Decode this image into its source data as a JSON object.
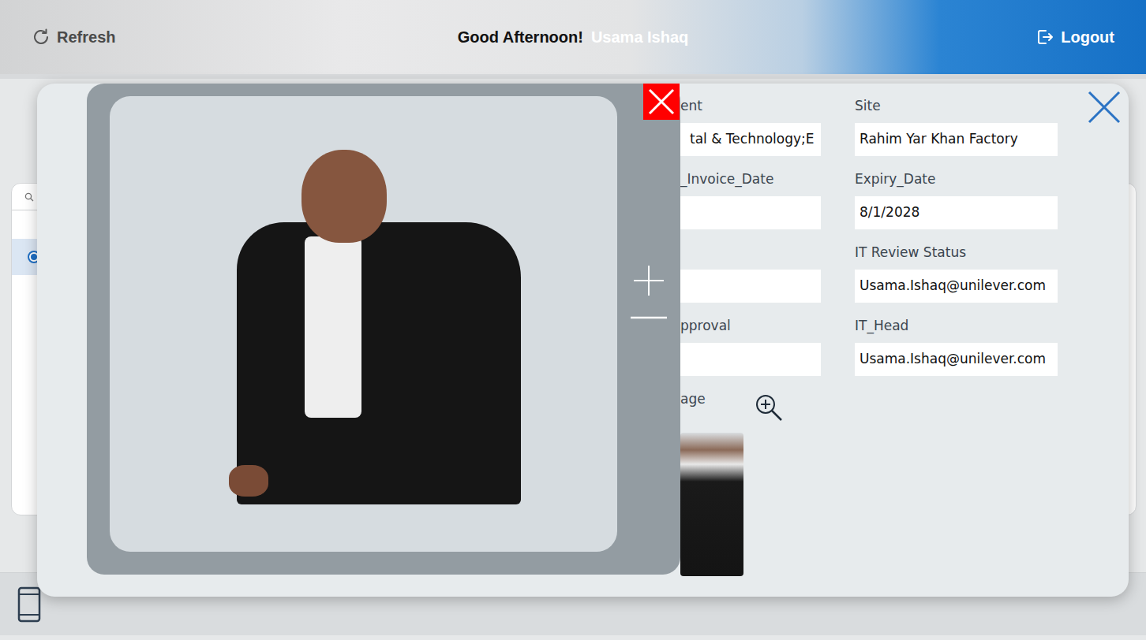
{
  "header": {
    "refresh": "Refresh",
    "greeting": "Good Afternoon!",
    "user": "Usama Ishaq",
    "logout": "Logout"
  },
  "list": {
    "rows": [
      {
        "selected": true
      }
    ]
  },
  "dialog": {
    "left_fields": [
      {
        "label": "ent",
        "value": "tal & Technology;E"
      },
      {
        "label": "_Invoice_Date",
        "value": ""
      },
      {
        "label": "",
        "value": ""
      },
      {
        "label": "pproval",
        "value": ""
      }
    ],
    "image_field": {
      "label": "age"
    },
    "right_fields": [
      {
        "label": "Site",
        "value": "Rahim Yar Khan Factory"
      },
      {
        "label": "Expiry_Date",
        "value": "8/1/2028"
      },
      {
        "label": "IT Review Status",
        "value": "Usama.Ishaq@unilever.com"
      },
      {
        "label": "IT_Head",
        "value": "Usama.Ishaq@unilever.com"
      }
    ]
  }
}
